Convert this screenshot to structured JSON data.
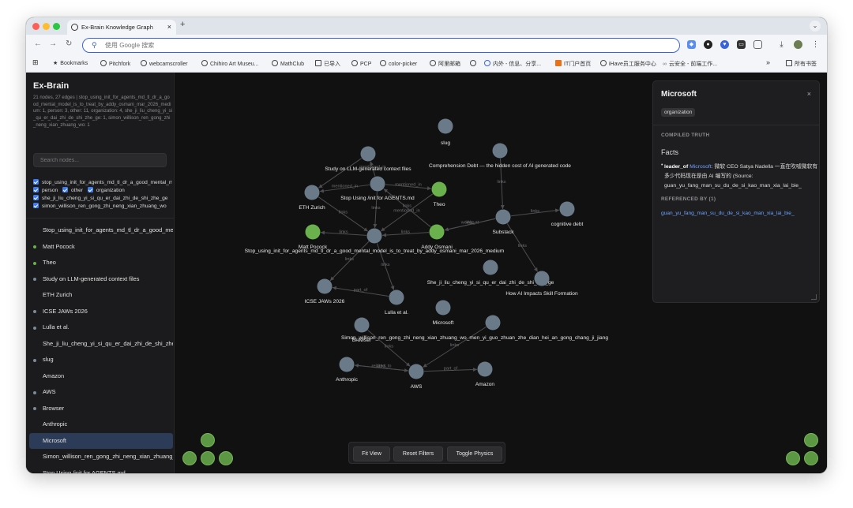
{
  "browser": {
    "tab_title": "Ex-Brain Knowledge Graph",
    "omnibox_placeholder": "使用 Google 搜索",
    "bookmarks": [
      "Bookmarks",
      "Pitchfork",
      "webcamscroller",
      "Chihiro Art Museu...",
      "MathClub",
      "已导入",
      "PCP",
      "color-picker",
      "阿里邮箱",
      "内外 - 信息、分享...",
      "IT门户首页",
      "iHave员工服务中心",
      "云安全 - 前端工作..."
    ],
    "all_bookmarks": "所有书签",
    "more": "»"
  },
  "sidebar": {
    "title": "Ex-Brain",
    "stats": "21 nodes, 27 edges | stop_using_init_for_agents_md_tl_dr_a_good_mental_model_is_to_treat_by_addy_osmani_mar_2026_medium: 1, person: 3, other: 11, organization: 4, she_ji_liu_cheng_yi_si_qu_er_dai_zhi_de_shi_zhe_ge: 1, simon_willison_ren_gong_zhi_neng_xian_zhuang_wo: 1",
    "search_placeholder": "Search nodes...",
    "filters": {
      "f1": "stop_using_init_for_agents_md_tl_dr_a_good_mental_model",
      "f2": "person",
      "f3": "other",
      "f4": "organization",
      "f5": "she_ji_liu_cheng_yi_si_qu_er_dai_zhi_de_shi_zhe_ge",
      "f6": "simon_willison_ren_gong_zhi_neng_xian_zhuang_wo"
    },
    "nodes": [
      {
        "label": "Stop_using_init_for_agents_md_tl_dr_a_good_mental_model",
        "dot": ""
      },
      {
        "label": "Matt Pocock",
        "dot": "#6ab04c"
      },
      {
        "label": "Theo",
        "dot": "#6ab04c"
      },
      {
        "label": "Study on LLM-generated context files",
        "dot": "#7a8a9a"
      },
      {
        "label": "ETH Zurich",
        "dot": ""
      },
      {
        "label": "ICSE JAWs 2026",
        "dot": "#7a8a9a"
      },
      {
        "label": "Lulla et al.",
        "dot": "#7a8a9a"
      },
      {
        "label": "She_ji_liu_cheng_yi_si_qu_er_dai_zhi_de_shi_zhe_ge",
        "dot": ""
      },
      {
        "label": "slug",
        "dot": "#7a8a9a"
      },
      {
        "label": "Amazon",
        "dot": ""
      },
      {
        "label": "AWS",
        "dot": "#7a8a9a"
      },
      {
        "label": "Browser",
        "dot": "#7a8a9a"
      },
      {
        "label": "Anthropic",
        "dot": ""
      },
      {
        "label": "Microsoft",
        "dot": "",
        "selected": true
      },
      {
        "label": "Simon_willison_ren_gong_zhi_neng_xian_zhuang_wo",
        "dot": ""
      },
      {
        "label": "Stop Using /init for AGENTS.md",
        "dot": ""
      }
    ]
  },
  "controls": {
    "fit_view": "Fit View",
    "reset_filters": "Reset Filters",
    "toggle_physics": "Toggle Physics"
  },
  "panel": {
    "title": "Microsoft",
    "badge": "organization",
    "close": "×",
    "section_compiled": "COMPILED TRUTH",
    "facts_heading": "Facts",
    "fact_relation": "leader_of",
    "fact_link": "Microsoft",
    "fact_text": ": 微软 CEO Satya Nadella 一直在吹嘘微软有多少代码现在是由 AI 编写的 (Source: guan_yu_fang_man_su_du_de_si_kao_man_xia_lai_bie_",
    "section_referenced": "REFERENCED BY (1)",
    "referenced_link": "guan_yu_fang_man_su_du_de_si_kao_man_xia_lai_bie_"
  },
  "graph": {
    "colors": {
      "other": "#6b7a88",
      "person": "#6ab04c",
      "edge": "#4e4e52"
    },
    "nodes": [
      {
        "id": "slug",
        "label": "slug",
        "type": "other"
      },
      {
        "id": "study",
        "label": "Study on LLM-generated context files",
        "type": "other"
      },
      {
        "id": "debt",
        "label": "Comprehension Debt — the hidden cost of AI generated code",
        "type": "other"
      },
      {
        "id": "eth",
        "label": "ETH Zurich",
        "type": "other"
      },
      {
        "id": "agentsmd",
        "label": "Stop Using /init for AGENTS.md",
        "type": "other"
      },
      {
        "id": "theo",
        "label": "Theo",
        "type": "person"
      },
      {
        "id": "substack",
        "label": "Substack",
        "type": "other"
      },
      {
        "id": "cogdebt",
        "label": "cognitive debt",
        "type": "other"
      },
      {
        "id": "matt",
        "label": "Matt Pocock",
        "type": "person"
      },
      {
        "id": "stop",
        "label": "Stop_using_init_for_agents_md_tl_dr_a_good_mental_model_is_to_treat_by_addy_osmani_mar_2026_medium",
        "type": "other"
      },
      {
        "id": "addy",
        "label": "Addy Osmani",
        "type": "person"
      },
      {
        "id": "sheji",
        "label": "She_ji_liu_cheng_yi_si_qu_er_dai_zhi_de_shi_zhe_ge",
        "type": "other"
      },
      {
        "id": "skill",
        "label": "How AI Impacts Skill Formation",
        "type": "other"
      },
      {
        "id": "icse",
        "label": "ICSE JAWs 2026",
        "type": "other"
      },
      {
        "id": "lulla",
        "label": "Lulla et al.",
        "type": "other"
      },
      {
        "id": "microsoft",
        "label": "Microsoft",
        "type": "other"
      },
      {
        "id": "simon",
        "label": "Simon_willison_ren_gong_zhi_neng_xian_zhuang_wo_men_yi_guo_zhuan_zhe_dian_hei_an_gong_chang_ji_jiang",
        "type": "other"
      },
      {
        "id": "browser",
        "label": "Browser",
        "type": "other"
      },
      {
        "id": "anthropic",
        "label": "Anthropic",
        "type": "other"
      },
      {
        "id": "aws",
        "label": "AWS",
        "type": "other"
      },
      {
        "id": "amazon",
        "label": "Amazon",
        "type": "other"
      }
    ],
    "edges": [
      {
        "from": "study",
        "to": "eth",
        "label": ""
      },
      {
        "from": "agentsmd",
        "to": "study",
        "label": "mentioned_in"
      },
      {
        "from": "agentsmd",
        "to": "theo",
        "label": "mentioned_in"
      },
      {
        "from": "agentsmd",
        "to": "eth",
        "label": "mentioned_in"
      },
      {
        "from": "eth",
        "to": "stop",
        "label": "links"
      },
      {
        "from": "agentsmd",
        "to": "stop",
        "label": "links"
      },
      {
        "from": "theo",
        "to": "stop",
        "label": "mentioned_in"
      },
      {
        "from": "stop",
        "to": "matt",
        "label": "links"
      },
      {
        "from": "addy",
        "to": "stop",
        "label": "links"
      },
      {
        "from": "addy",
        "to": "agentsmd",
        "label": "links"
      },
      {
        "from": "substack",
        "to": "addy",
        "label": "works_at"
      },
      {
        "from": "substack",
        "to": "addy",
        "label": "links"
      },
      {
        "from": "debt",
        "to": "substack",
        "label": "links"
      },
      {
        "from": "substack",
        "to": "cogdebt",
        "label": "links"
      },
      {
        "from": "substack",
        "to": "skill",
        "label": "links"
      },
      {
        "from": "stop",
        "to": "icse",
        "label": "links"
      },
      {
        "from": "lulla",
        "to": "icse",
        "label": "part_of"
      },
      {
        "from": "stop",
        "to": "lulla",
        "label": "links"
      },
      {
        "from": "browser",
        "to": "aws",
        "label": "links"
      },
      {
        "from": "aws",
        "to": "anthropic",
        "label": "links"
      },
      {
        "from": "anthropic",
        "to": "aws",
        "label": "related_to"
      },
      {
        "from": "aws",
        "to": "amazon",
        "label": "part_of"
      },
      {
        "from": "simon",
        "to": "aws",
        "label": "links"
      }
    ]
  }
}
